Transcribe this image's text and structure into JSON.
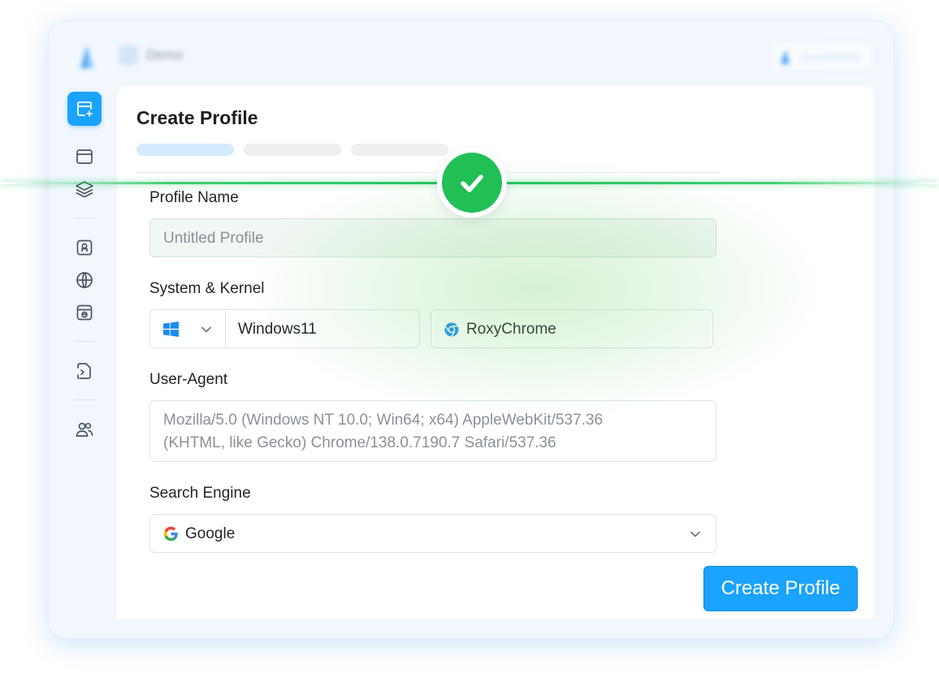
{
  "app": {
    "workspace_name": "Demo"
  },
  "sidebar": {
    "items": [
      {
        "icon": "new-window-icon",
        "active": true
      },
      {
        "icon": "browser-window-icon",
        "active": false
      },
      {
        "icon": "layers-icon",
        "active": false
      },
      {
        "icon": "id-badge-icon",
        "active": false
      },
      {
        "icon": "globe-icon",
        "active": false
      },
      {
        "icon": "extension-box-icon",
        "active": false
      },
      {
        "icon": "script-file-icon",
        "active": false
      },
      {
        "icon": "team-icon",
        "active": false
      }
    ]
  },
  "page": {
    "title": "Create Profile",
    "steps": [
      {
        "state": "active"
      },
      {
        "state": "pending"
      },
      {
        "state": "pending"
      }
    ]
  },
  "form": {
    "profile_name": {
      "label": "Profile Name",
      "placeholder": "Untitled Profile"
    },
    "system_kernel": {
      "label": "System & Kernel",
      "os_icon": "windows-icon",
      "os_value": "Windows11",
      "kernel_icon": "roxychrome-icon",
      "kernel_value": "RoxyChrome"
    },
    "user_agent": {
      "label": "User-Agent",
      "line1": "Mozilla/5.0 (Windows NT 10.0; Win64; x64) AppleWebKit/537.36",
      "line2": "(KHTML, like Gecko) Chrome/138.0.7190.7 Safari/537.36"
    },
    "search_engine": {
      "label": "Search Engine",
      "icon": "google-icon",
      "value": "Google"
    },
    "submit_label": "Create Profile"
  },
  "overlay": {
    "icon": "checkmark-icon",
    "status": "success"
  },
  "colors": {
    "accent": "#1aa3ff",
    "success": "#22bf55",
    "step_active": "#d3ebfd",
    "background": "#f1f7fd"
  }
}
